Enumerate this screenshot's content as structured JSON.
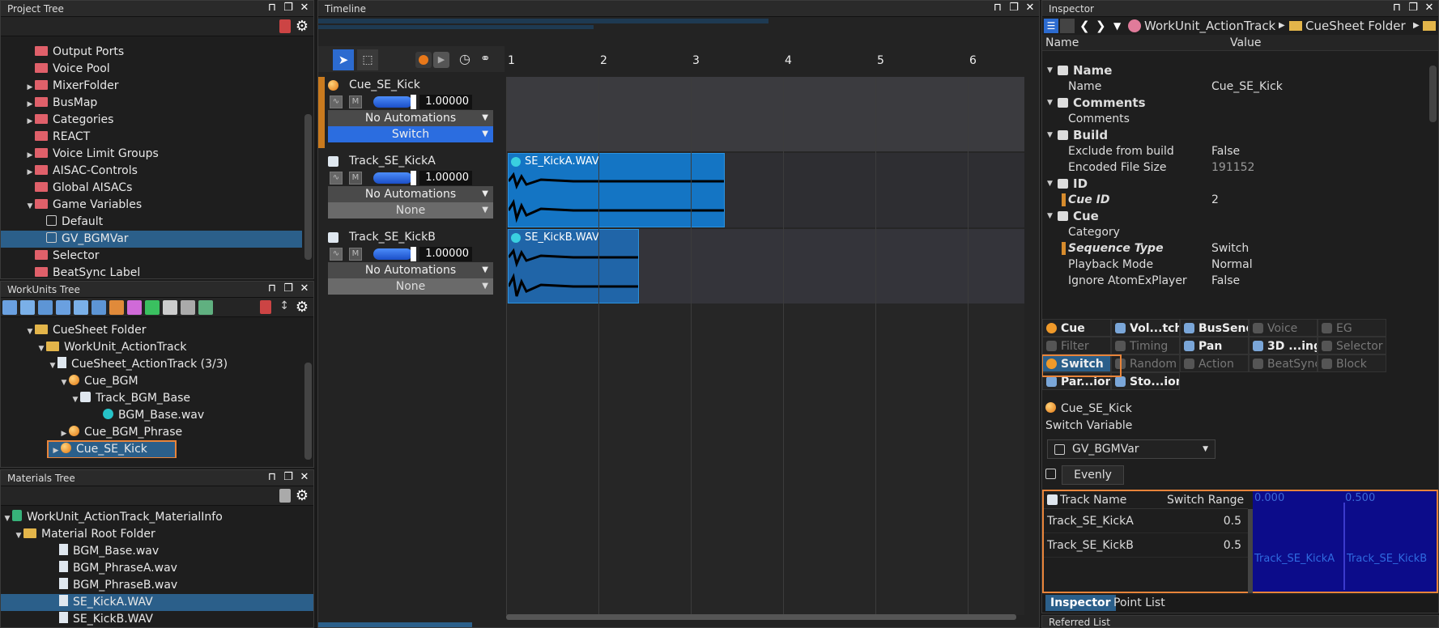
{
  "project_tree": {
    "title": "Project Tree",
    "items": [
      {
        "label": "Output Ports",
        "icon": "folder-red",
        "arrow": ""
      },
      {
        "label": "Voice Pool",
        "icon": "folder-red",
        "arrow": ""
      },
      {
        "label": "MixerFolder",
        "icon": "folder-red",
        "arrow": "▶"
      },
      {
        "label": "BusMap",
        "icon": "folder-red",
        "arrow": "▶"
      },
      {
        "label": "Categories",
        "icon": "folder-red",
        "arrow": "▶"
      },
      {
        "label": "REACT",
        "icon": "folder-red",
        "arrow": ""
      },
      {
        "label": "Voice Limit Groups",
        "icon": "folder-red",
        "arrow": "▶"
      },
      {
        "label": "AISAC-Controls",
        "icon": "folder-red",
        "arrow": "▶"
      },
      {
        "label": "Global AISACs",
        "icon": "folder-red",
        "arrow": ""
      },
      {
        "label": "Game Variables",
        "icon": "folder-red",
        "arrow": "▼"
      },
      {
        "label": "Default",
        "icon": "variable",
        "arrow": ""
      },
      {
        "label": "GV_BGMVar",
        "icon": "variable",
        "arrow": ""
      },
      {
        "label": "Selector",
        "icon": "folder-red",
        "arrow": ""
      },
      {
        "label": "BeatSync Label",
        "icon": "folder-red",
        "arrow": ""
      }
    ]
  },
  "workunits_tree": {
    "title": "WorkUnits Tree",
    "items": [
      {
        "label": "CueSheet Folder",
        "icon": "folder-yellow",
        "arrow": "▼"
      },
      {
        "label": "WorkUnit_ActionTrack",
        "icon": "folder-yellow",
        "arrow": "▼"
      },
      {
        "label": "CueSheet_ActionTrack (3/3)",
        "icon": "doc",
        "arrow": "▼"
      },
      {
        "label": "Cue_BGM",
        "icon": "cue",
        "arrow": "▼"
      },
      {
        "label": "Track_BGM_Base",
        "icon": "track",
        "arrow": "▼"
      },
      {
        "label": "BGM_Base.wav",
        "icon": "wave",
        "arrow": ""
      },
      {
        "label": "Cue_BGM_Phrase",
        "icon": "cue",
        "arrow": "▶"
      },
      {
        "label": "Cue_SE_Kick",
        "icon": "cue",
        "arrow": "▶"
      }
    ]
  },
  "materials_tree": {
    "title": "Materials Tree",
    "items": [
      {
        "label": "WorkUnit_ActionTrack_MaterialInfo",
        "icon": "info",
        "arrow": "▼"
      },
      {
        "label": "Material Root Folder",
        "icon": "folder-yellow",
        "arrow": "▼"
      },
      {
        "label": "BGM_Base.wav",
        "icon": "doc",
        "arrow": ""
      },
      {
        "label": "BGM_PhraseA.wav",
        "icon": "doc",
        "arrow": ""
      },
      {
        "label": "BGM_PhraseB.wav",
        "icon": "doc",
        "arrow": ""
      },
      {
        "label": "SE_KickA.WAV",
        "icon": "doc",
        "arrow": ""
      },
      {
        "label": "SE_KickB.WAV",
        "icon": "doc",
        "arrow": ""
      }
    ]
  },
  "timeline": {
    "title": "Timeline",
    "ruler": [
      "1",
      "2",
      "3",
      "4",
      "5",
      "6"
    ],
    "lanes": [
      {
        "name": "Cue_SE_Kick",
        "icon": "cue",
        "mute": "M",
        "volume": "1.00000",
        "automation": "No Automations",
        "third": "Switch"
      },
      {
        "name": "Track_SE_KickA",
        "icon": "track",
        "mute": "M",
        "volume": "1.00000",
        "automation": "No Automations",
        "third": "None"
      },
      {
        "name": "Track_SE_KickB",
        "icon": "track",
        "mute": "M",
        "volume": "1.00000",
        "automation": "No Automations",
        "third": "None"
      }
    ],
    "regions": [
      {
        "label": "SE_KickA.WAV"
      },
      {
        "label": "SE_KickB.WAV"
      }
    ]
  },
  "inspector": {
    "title": "Inspector",
    "breadcrumb": [
      "WorkUnit_ActionTrack",
      "CueSheet Folder"
    ],
    "col_name": "Name",
    "col_value": "Value",
    "sections": [
      {
        "head": "Name",
        "rows": [
          {
            "k": "Name",
            "v": "Cue_SE_Kick"
          }
        ]
      },
      {
        "head": "Comments",
        "rows": [
          {
            "k": "Comments",
            "v": ""
          }
        ]
      },
      {
        "head": "Build",
        "rows": [
          {
            "k": "Exclude from build",
            "v": "False"
          },
          {
            "k": "Encoded File Size",
            "v": "191152"
          }
        ]
      },
      {
        "head": "ID",
        "rows": [
          {
            "k": "Cue ID",
            "v": "2"
          }
        ]
      },
      {
        "head": "Cue",
        "rows": [
          {
            "k": "Category",
            "v": ""
          },
          {
            "k": "Sequence Type",
            "v": "Switch"
          },
          {
            "k": "Playback Mode",
            "v": "Normal"
          },
          {
            "k": "Ignore AtomExPlayer",
            "v": "False"
          }
        ]
      }
    ],
    "tabs": [
      "Cue",
      "Vol...tch",
      "BusSend",
      "Voice",
      "EG",
      "Filter",
      "Timing",
      "Pan",
      "3D ...ing",
      "Selector",
      "Switch",
      "Random",
      "Action",
      "BeatSync",
      "Block",
      "Par...ion",
      "Sto...ion"
    ],
    "cue_name": "Cue_SE_Kick",
    "switch_variable_label": "Switch Variable",
    "switch_variable": "GV_BGMVar",
    "evenly": "Evenly",
    "table": {
      "col_track": "Track Name",
      "col_range": "Switch Range",
      "axis": [
        "0.000",
        "0.500"
      ],
      "rows": [
        {
          "track": "Track_SE_KickA",
          "range": "0.5"
        },
        {
          "track": "Track_SE_KickB",
          "range": "0.5"
        }
      ]
    },
    "bottom_tabs": [
      "Inspector",
      "Point List"
    ]
  },
  "referred_list": {
    "title": "Referred List"
  }
}
